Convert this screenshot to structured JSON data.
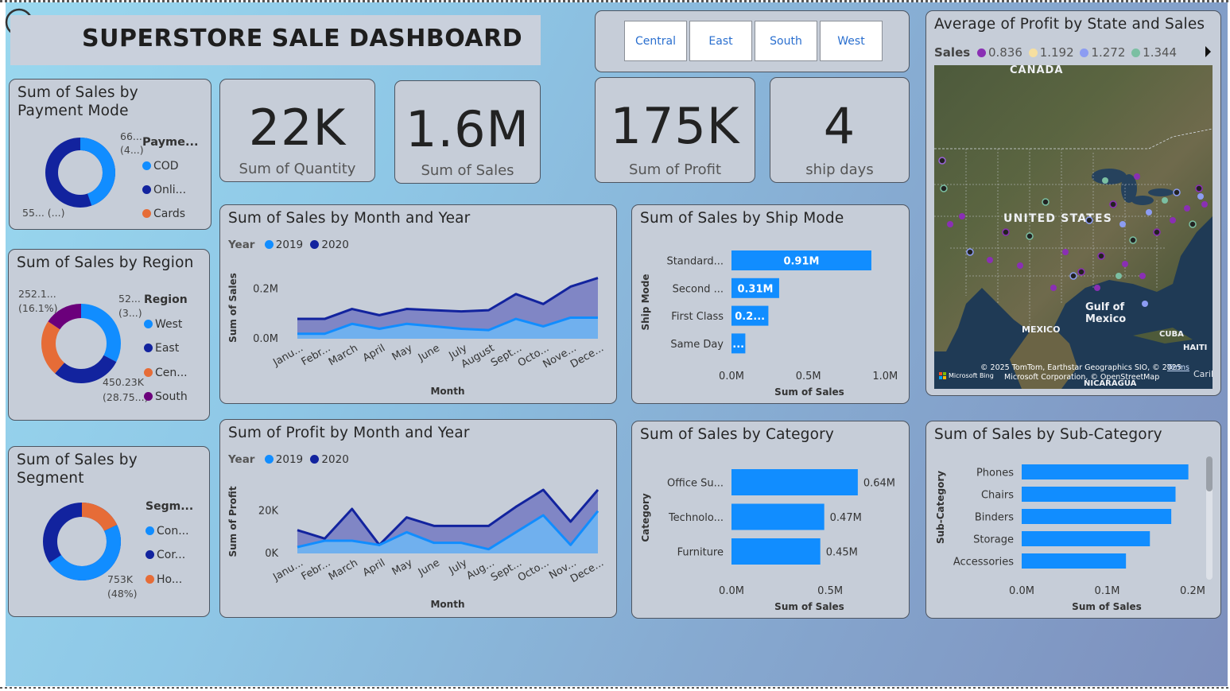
{
  "title": "SUPERSTORE SALE DASHBOARD",
  "colors": {
    "light_blue": "#118dff",
    "dark_blue": "#12239e",
    "orange": "#e66c37",
    "purple": "#6b007b",
    "card_bg": "#c6cdd8"
  },
  "region_buttons": [
    "Central",
    "East",
    "South",
    "West"
  ],
  "kpis": {
    "quantity": {
      "value": "22K",
      "label": "Sum of Quantity"
    },
    "sales": {
      "value": "1.6M",
      "label": "Sum of Sales"
    },
    "profit": {
      "value": "175K",
      "label": "Sum of Profit"
    },
    "ship_days": {
      "value": "4",
      "label": "ship days"
    }
  },
  "payment": {
    "title": "Sum of Sales by Payment Mode",
    "legend_title": "Payme...",
    "items": [
      "COD",
      "Onli...",
      "Cards"
    ],
    "label_top_a": "66...",
    "label_top_b": "(4...)",
    "label_bottom": "55... (...)"
  },
  "region": {
    "title": "Sum of Sales by Region",
    "legend_title": "Region",
    "items": [
      "West",
      "East",
      "Cen...",
      "South"
    ],
    "label_tl_a": "252.1...",
    "label_tl_b": "(16.1%)",
    "label_tr_a": "52...",
    "label_tr_b": "(3...)",
    "label_br_a": "450.23K",
    "label_br_b": "(28.75...)"
  },
  "segment": {
    "title": "Sum of Sales by Segment",
    "legend_title": "Segm...",
    "items": [
      "Con...",
      "Cor...",
      "Ho..."
    ],
    "label_a": "753K",
    "label_b": "(48%)"
  },
  "map": {
    "title": "Average of Profit by State and Sales",
    "legend_title": "Sales",
    "legend": [
      "0.836",
      "1.192",
      "1.272",
      "1.344"
    ],
    "labels": {
      "canada": "CANADA",
      "us": "UNITED STATES",
      "gulf_a": "Gulf of",
      "gulf_b": "Mexico",
      "mexico": "MEXICO",
      "cuba": "CUBA",
      "haiti": "HAITI",
      "nicaragua": "NICARAGUA",
      "caribbean": "Caribbe"
    },
    "attribution_a": "© 2025 TomTom, Earthstar Geographics SIO, © 2025",
    "attribution_b": "Microsoft Corporation, © OpenStreetMap",
    "terms": "Terms",
    "bing": "Microsoft Bing"
  },
  "chart_data": [
    {
      "type": "area",
      "title": "Sum of Sales by Month and Year",
      "legend_title": "Year",
      "xlabel": "Month",
      "ylabel": "Sum of Sales",
      "yticks": [
        "0.2M",
        "0.0M"
      ],
      "categories": [
        "Janu...",
        "Febr...",
        "March",
        "April",
        "May",
        "June",
        "July",
        "August",
        "Sept...",
        "Octo...",
        "Nove...",
        "Dece..."
      ],
      "ylim": [
        0,
        0.25
      ],
      "series": [
        {
          "name": "2019",
          "values": [
            0.02,
            0.02,
            0.06,
            0.04,
            0.06,
            0.05,
            0.04,
            0.035,
            0.08,
            0.05,
            0.085,
            0.085
          ]
        },
        {
          "name": "2020",
          "values": [
            0.08,
            0.08,
            0.12,
            0.095,
            0.12,
            0.115,
            0.11,
            0.115,
            0.18,
            0.14,
            0.21,
            0.245
          ]
        }
      ]
    },
    {
      "type": "area",
      "title": "Sum of Profit by Month and Year",
      "legend_title": "Year",
      "xlabel": "Month",
      "ylabel": "Sum of Profit",
      "yticks": [
        "20K",
        "0K"
      ],
      "categories": [
        "Janu...",
        "Febr...",
        "March",
        "April",
        "May",
        "June",
        "July",
        "Aug...",
        "Sept...",
        "Octo...",
        "Nov...",
        "Dece..."
      ],
      "ylim": [
        0,
        30
      ],
      "series": [
        {
          "name": "2019",
          "values": [
            3,
            6,
            6,
            4,
            10,
            5,
            5,
            2,
            10,
            18,
            4,
            20
          ]
        },
        {
          "name": "2020",
          "values": [
            11,
            7,
            21,
            4,
            17,
            13,
            13,
            13,
            22,
            30,
            15,
            30
          ]
        }
      ]
    },
    {
      "type": "bar",
      "title": "Sum of Sales by Ship Mode",
      "xlabel": "Sum of Sales",
      "ylabel": "Ship Mode",
      "categories": [
        "Standard...",
        "Second ...",
        "First Class",
        "Same Day"
      ],
      "values": [
        0.91,
        0.31,
        0.24,
        0.09
      ],
      "data_labels": [
        "0.91M",
        "0.31M",
        "0.2...",
        "..."
      ],
      "xticks": [
        "0.0M",
        "0.5M",
        "1.0M"
      ],
      "xlim": [
        0,
        1.2
      ]
    },
    {
      "type": "bar",
      "title": "Sum of Sales by Category",
      "xlabel": "Sum of Sales",
      "ylabel": "Category",
      "categories": [
        "Office Su...",
        "Technolo...",
        "Furniture"
      ],
      "values": [
        0.64,
        0.47,
        0.45
      ],
      "data_labels": [
        "0.64M",
        "0.47M",
        "0.45M"
      ],
      "xticks": [
        "0.0M",
        "0.5M"
      ],
      "xlim": [
        0,
        0.85
      ]
    },
    {
      "type": "bar",
      "title": "Sum of Sales by Sub-Category",
      "xlabel": "Sum of Sales",
      "ylabel": "Sub-Category",
      "categories": [
        "Phones",
        "Chairs",
        "Binders",
        "Storage",
        "Accessories"
      ],
      "values": [
        0.195,
        0.18,
        0.175,
        0.15,
        0.122
      ],
      "xticks": [
        "0.0M",
        "0.1M",
        "0.2M"
      ],
      "xlim": [
        0,
        0.2
      ]
    }
  ]
}
